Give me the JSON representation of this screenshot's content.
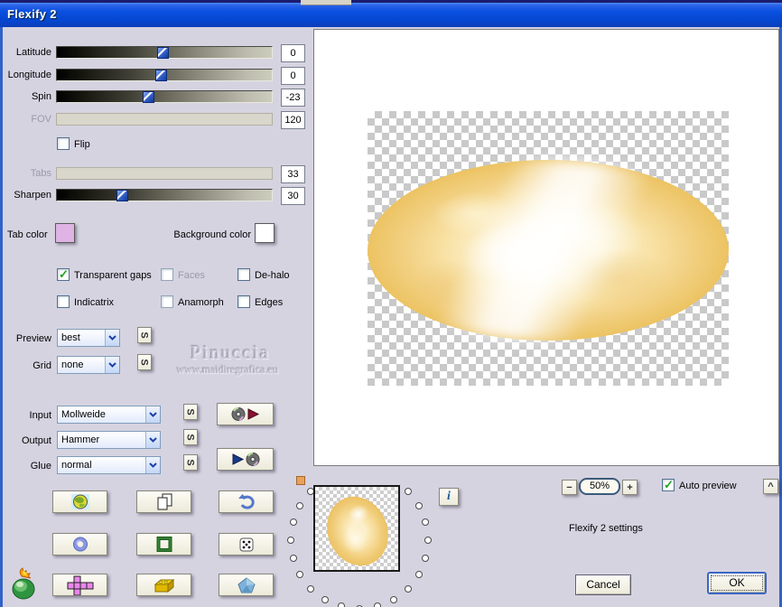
{
  "window": {
    "title": "Flexify 2"
  },
  "sliders": [
    {
      "label": "Latitude",
      "value": "0",
      "percent": 49,
      "enabled": true
    },
    {
      "label": "Longitude",
      "value": "0",
      "percent": 48,
      "enabled": true
    },
    {
      "label": "Spin",
      "value": "-23",
      "percent": 42,
      "enabled": true
    },
    {
      "label": "FOV",
      "value": "120",
      "percent": null,
      "enabled": false
    },
    {
      "label": "Tabs",
      "value": "33",
      "percent": null,
      "enabled": false
    },
    {
      "label": "Sharpen",
      "value": "30",
      "percent": 30,
      "enabled": true
    }
  ],
  "flip": {
    "label": "Flip",
    "checked": false
  },
  "colors": {
    "tab_color_label": "Tab color",
    "tab_color": "#dfb3e3",
    "background_color_label": "Background color",
    "background_color": "#ffffff"
  },
  "options": {
    "transparent_gaps": {
      "label": "Transparent gaps",
      "checked": true
    },
    "faces": {
      "label": "Faces",
      "checked": false,
      "disabled": true
    },
    "dehalo": {
      "label": "De-halo",
      "checked": false
    },
    "indicatrix": {
      "label": "Indicatrix",
      "checked": false
    },
    "anamorph": {
      "label": "Anamorph",
      "checked": false
    },
    "edges": {
      "label": "Edges",
      "checked": false
    }
  },
  "combos": {
    "preview": {
      "label": "Preview",
      "value": "best"
    },
    "grid": {
      "label": "Grid",
      "value": "none"
    },
    "input": {
      "label": "Input",
      "value": "Mollweide"
    },
    "output": {
      "label": "Output",
      "value": "Hammer"
    },
    "glue": {
      "label": "Glue",
      "value": "normal"
    }
  },
  "glyphs": {
    "s": "S",
    "check": "✓",
    "minus": "−",
    "plus": "+",
    "caret": "^",
    "info": "i"
  },
  "icon_buttons": [
    "globe-icon",
    "copy-icon",
    "undo-icon",
    "ring-icon",
    "square-ring-icon",
    "dice-icon",
    "unfolded-cube-icon",
    "brick-icon",
    "pentagon-icon",
    "cd-load-icon",
    "cd-save-icon",
    "flaming-pear-logo"
  ],
  "watermark": {
    "line1": "Pinuccia",
    "line2": "www.maidiregrafica.eu"
  },
  "zoombar": {
    "zoom_level": "50%",
    "auto_preview_label": "Auto preview",
    "auto_preview_checked": true
  },
  "status": {
    "settings_text": "Flexify 2 settings"
  },
  "actions": {
    "cancel": "Cancel",
    "ok": "OK"
  }
}
